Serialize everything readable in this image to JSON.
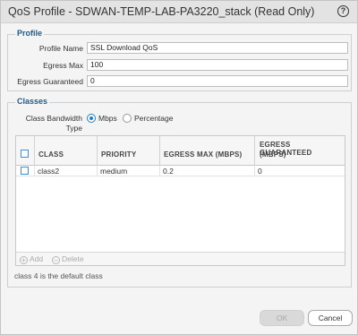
{
  "dialog": {
    "title": "QoS Profile - SDWAN-TEMP-LAB-PA3220_stack (Read Only)",
    "help_glyph": "?"
  },
  "profile_section": {
    "heading": "Profile",
    "fields": {
      "profile_name": {
        "label": "Profile Name",
        "value": "SSL Download QoS"
      },
      "egress_max": {
        "label": "Egress Max",
        "value": "100"
      },
      "egress_guaranteed": {
        "label": "Egress Guaranteed",
        "value": "0"
      }
    }
  },
  "classes_section": {
    "heading": "Classes",
    "bandwidth_type": {
      "label_line1": "Class Bandwidth",
      "label_line2": "Type",
      "options": [
        "Mbps",
        "Percentage"
      ],
      "selected": "Mbps"
    },
    "table": {
      "columns": [
        "CLASS",
        "PRIORITY",
        "EGRESS MAX (MBPS)",
        "EGRESS GUARANTEED",
        "(MBPS)"
      ],
      "rows": [
        {
          "class": "class2",
          "priority": "medium",
          "egress_max": "0.2",
          "egress_guaranteed": "0"
        }
      ]
    },
    "toolbar": {
      "add_label": "Add",
      "delete_label": "Delete"
    },
    "default_note": "class 4 is the default class"
  },
  "buttons": {
    "ok_label": "OK",
    "cancel_label": "Cancel"
  },
  "colors": {
    "accent": "#1e7ec8",
    "section_heading": "#1d5b8c",
    "title_bar": "#e3e3e3"
  }
}
